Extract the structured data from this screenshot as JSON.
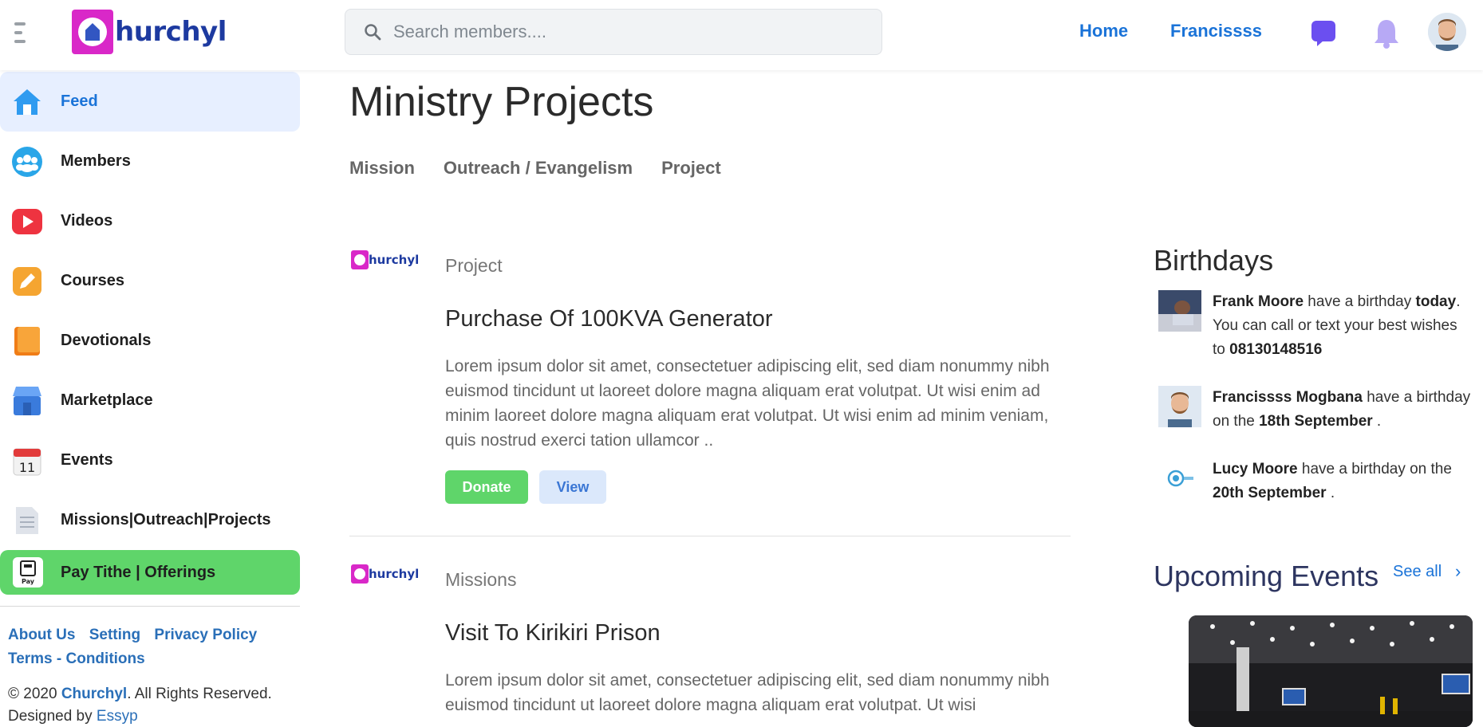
{
  "header": {
    "logo_text": "hurchyl",
    "search_placeholder": "Search members....",
    "nav": {
      "home": "Home",
      "profile": "Francissss"
    }
  },
  "sidebar": {
    "items": [
      {
        "label": "Feed",
        "icon": "home-icon",
        "active": true
      },
      {
        "label": "Members",
        "icon": "members-icon"
      },
      {
        "label": "Videos",
        "icon": "video-play-icon"
      },
      {
        "label": "Courses",
        "icon": "pencil-icon"
      },
      {
        "label": "Devotionals",
        "icon": "book-icon"
      },
      {
        "label": "Marketplace",
        "icon": "shop-icon"
      },
      {
        "label": "Events",
        "icon": "calendar-icon",
        "calendar_day": "11"
      },
      {
        "label": "Missions|Outreach|Projects",
        "icon": "document-icon"
      }
    ],
    "pay_button": {
      "label": "Pay Tithe | Offerings",
      "icon_text": "Pay"
    },
    "footer_links": [
      "About Us",
      "Setting",
      "Privacy Policy",
      "Terms - Conditions"
    ],
    "copyright_prefix": "© 2020",
    "copyright_brand": "Churchyl",
    "copyright_suffix": ". All Rights Reserved.",
    "designed_by_prefix": "Designed by",
    "designed_by_link": "Essyp"
  },
  "main": {
    "page_title": "Ministry Projects",
    "tabs": [
      "Mission",
      "Outreach / Evangelism",
      "Project"
    ],
    "cards": [
      {
        "logo_text": "hurchyl",
        "category": "Project",
        "title": "Purchase Of 100KVA Generator",
        "description": "Lorem ipsum dolor sit amet, consectetuer adipiscing elit, sed diam nonummy nibh euismod tincidunt ut laoreet dolore magna aliquam erat volutpat. Ut wisi enim ad minim laoreet dolore magna aliquam erat volutpat. Ut wisi enim ad minim veniam, quis nostrud exerci tation ullamcor ..",
        "donate_label": "Donate",
        "view_label": "View"
      },
      {
        "logo_text": "hurchyl",
        "category": "Missions",
        "title": "Visit To Kirikiri Prison",
        "description": "Lorem ipsum dolor sit amet, consectetuer adipiscing elit, sed diam nonummy nibh euismod tincidunt ut laoreet dolore magna aliquam erat volutpat. Ut wisi"
      }
    ]
  },
  "right_panel": {
    "birthdays_title": "Birthdays",
    "birthdays": [
      {
        "name": "Frank Moore",
        "t1": " have a birthday ",
        "bold2": "today",
        "t2": ". You can call or text your best wishes to ",
        "bold3": "08130148516",
        "t3": ""
      },
      {
        "name": "Francissss Mogbana",
        "t1": " have a birthday on the ",
        "bold2": "18th September",
        "t2": " .",
        "bold3": "",
        "t3": ""
      },
      {
        "name": "Lucy Moore",
        "t1": " have a birthday on the ",
        "bold2": "20th September",
        "t2": " .",
        "bold3": "",
        "t3": ""
      }
    ],
    "events_title": "Upcoming Events",
    "see_all": "See all",
    "see_all_chevron": "›"
  },
  "colors": {
    "accent": "#1a73d8",
    "active_bg": "#e7efff",
    "pay_green": "#5fd56a",
    "logo_magenta": "#d928c8",
    "logo_blue": "#1d3aa0"
  }
}
